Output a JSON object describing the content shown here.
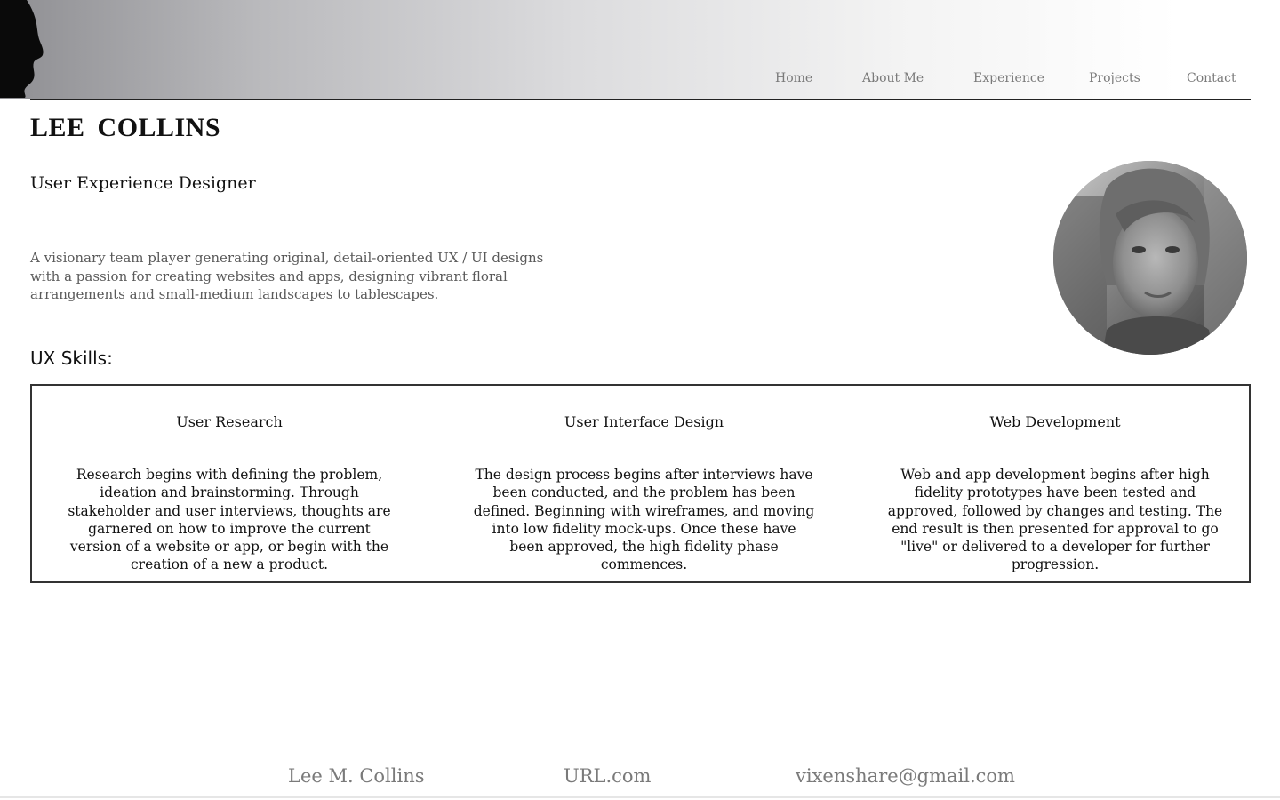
{
  "nav": {
    "items": [
      {
        "label": "Home"
      },
      {
        "label": "About Me"
      },
      {
        "label": "Experience"
      },
      {
        "label": "Projects"
      },
      {
        "label": "Contact"
      }
    ]
  },
  "profile": {
    "name": "LEE  COLLINS",
    "role": "User Experience Designer",
    "intro": "A visionary team player generating original, detail-oriented UX / UI designs with a passion for creating websites and apps, designing vibrant floral arrangements and small-medium landscapes to tablescapes."
  },
  "skills": {
    "heading": "UX Skills:",
    "items": [
      {
        "title": "User Research",
        "description": "Research begins with defining the problem, ideation and brainstorming. Through stakeholder and user interviews, thoughts are garnered on how to improve the current version of a website or app, or begin with the creation of a new a product."
      },
      {
        "title": "User Interface Design",
        "description": "The design process begins after interviews have been conducted, and the problem has been defined. Beginning with wireframes, and moving into low fidelity mock-ups. Once these have been approved, the high fidelity phase commences."
      },
      {
        "title": "Web Development",
        "description": "Web and app development begins after high fidelity prototypes have been tested and approved, followed by changes and testing. The end result is then presented for approval to go \"live\" or delivered to a developer for further progression."
      }
    ]
  },
  "footer": {
    "name": "Lee M. Collins",
    "url": "URL.com",
    "email": "vixenshare@gmail.com"
  },
  "icons": {
    "logo": "head-silhouette-icon",
    "avatar": "profile-photo"
  },
  "colors": {
    "nav_text": "#7a7a7a",
    "body_text": "#111111",
    "intro_text": "#5a5a5a",
    "border": "#333333"
  }
}
